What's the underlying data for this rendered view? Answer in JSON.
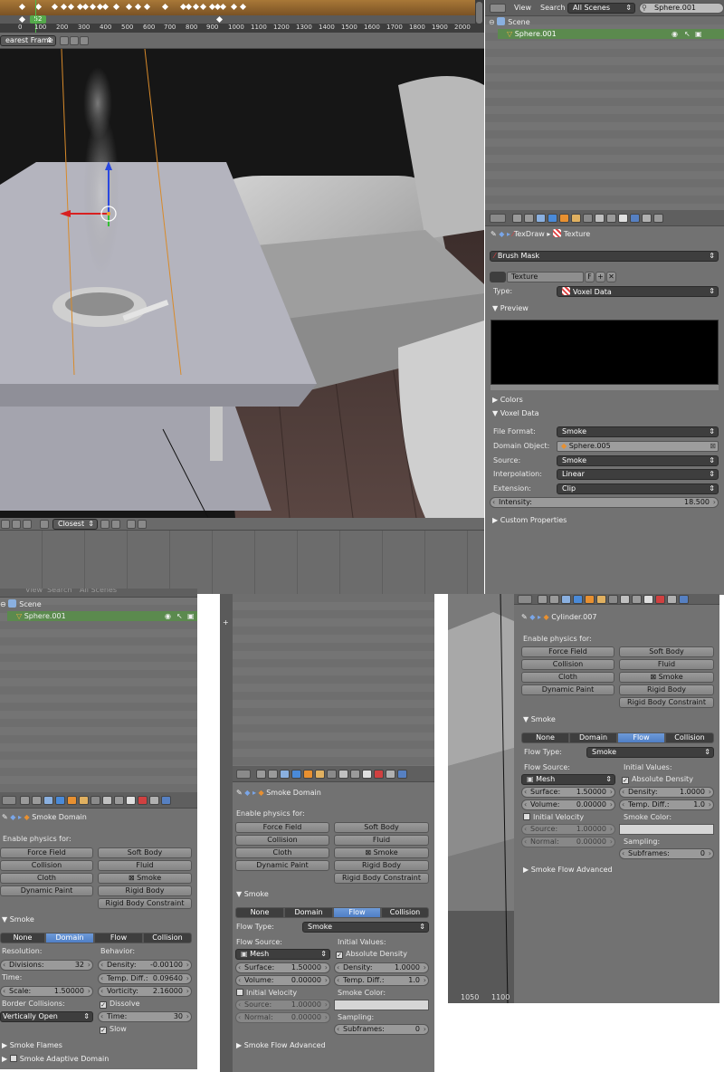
{
  "timeline": {
    "ticks": [
      "0",
      "0",
      "100",
      "200",
      "300",
      "400",
      "500",
      "600",
      "700",
      "800",
      "900",
      "1000",
      "1100",
      "1200",
      "1300",
      "1400",
      "1500",
      "1600",
      "1700",
      "1800",
      "1900",
      "2000",
      "2100"
    ],
    "current_frame": "52",
    "snap_mode": "earest Frame"
  },
  "viewport": {
    "shading_mode": "Closest"
  },
  "outliner_top": {
    "menu_view": "View",
    "menu_search": "Search",
    "scenes_dropdown": "All Scenes",
    "search_value": "Sphere.001",
    "tree_scene": "Scene",
    "tree_object": "Sphere.001"
  },
  "texture_panel": {
    "breadcrumb_brush": "TexDraw",
    "breadcrumb_texture": "Texture",
    "brush_mask": "Brush Mask",
    "texture_name": "Texture",
    "texture_f": "F",
    "type_label": "Type:",
    "type_value": "Voxel Data",
    "preview_header": "Preview",
    "colors_header": "Colors",
    "voxel_header": "Voxel Data",
    "file_format_label": "File Format:",
    "file_format_value": "Smoke",
    "domain_object_label": "Domain Object:",
    "domain_object_value": "Sphere.005",
    "source_label": "Source:",
    "source_value": "Smoke",
    "interpolation_label": "Interpolation:",
    "interpolation_value": "Linear",
    "extension_label": "Extension:",
    "extension_value": "Clip",
    "intensity_label": "Intensity:",
    "intensity_value": "18.500",
    "custom_props_header": "Custom Properties"
  },
  "outliner_small": {
    "menu_view": "View",
    "menu_search": "Search",
    "scenes": "All Scenes",
    "tree_scene": "Scene",
    "tree_object": "Sphere.001"
  },
  "physics_domain": {
    "object": "Smoke Domain",
    "enable_label": "Enable physics for:",
    "force_field": "Force Field",
    "soft_body": "Soft Body",
    "collision": "Collision",
    "fluid": "Fluid",
    "cloth": "Cloth",
    "smoke": "Smoke",
    "dynamic_paint": "Dynamic Paint",
    "rigid_body": "Rigid Body",
    "rigid_body_constraint": "Rigid Body Constraint",
    "smoke_header": "Smoke",
    "tab_none": "None",
    "tab_domain": "Domain",
    "tab_flow": "Flow",
    "tab_collision": "Collision",
    "resolution_label": "Resolution:",
    "divisions_label": "Divisions:",
    "divisions_value": "32",
    "time_label": "Time:",
    "scale_label": "Scale:",
    "scale_value": "1.50000",
    "border_label": "Border Collisions:",
    "border_value": "Vertically Open",
    "behavior_label": "Behavior:",
    "density_label": "Density:",
    "density_value": "-0.00100",
    "temp_diff_label": "Temp. Diff.:",
    "temp_diff_value": "0.09640",
    "vorticity_label": "Vorticity:",
    "vorticity_value": "2.16000",
    "dissolve_label": "Dissolve",
    "time_field_label": "Time:",
    "time_field_value": "30",
    "slow_label": "Slow",
    "flames_header": "Smoke Flames",
    "adaptive_header": "Smoke Adaptive Domain"
  },
  "physics_flow_mid": {
    "object": "Smoke Domain",
    "enable_label": "Enable physics for:",
    "force_field": "Force Field",
    "soft_body": "Soft Body",
    "collision": "Collision",
    "fluid": "Fluid",
    "cloth": "Cloth",
    "smoke": "Smoke",
    "dynamic_paint": "Dynamic Paint",
    "rigid_body": "Rigid Body",
    "rigid_body_constraint": "Rigid Body Constraint",
    "smoke_header": "Smoke",
    "tab_none": "None",
    "tab_domain": "Domain",
    "tab_flow": "Flow",
    "tab_collision": "Collision",
    "flow_type_label": "Flow Type:",
    "flow_type_value": "Smoke",
    "flow_source_label": "Flow Source:",
    "flow_source_value": "Mesh",
    "initial_values_label": "Initial Values:",
    "absolute_density_label": "Absolute Density",
    "surface_label": "Surface:",
    "surface_value": "1.50000",
    "volume_label": "Volume:",
    "volume_value": "0.00000",
    "density_label": "Density:",
    "density_value": "1.0000",
    "temp_diff_label": "Temp. Diff.:",
    "temp_diff_value": "1.0",
    "initial_velocity_label": "Initial Velocity",
    "smoke_color_label": "Smoke Color:",
    "source_label": "Source:",
    "source_value": "1.00000",
    "normal_label": "Normal:",
    "normal_value": "0.00000",
    "sampling_label": "Sampling:",
    "subframes_label": "Subframes:",
    "subframes_value": "0",
    "advanced_header": "Smoke Flow Advanced"
  },
  "physics_flow_right": {
    "object": "Cylinder.007",
    "enable_label": "Enable physics for:",
    "force_field": "Force Field",
    "soft_body": "Soft Body",
    "collision": "Collision",
    "fluid": "Fluid",
    "cloth": "Cloth",
    "smoke": "Smoke",
    "dynamic_paint": "Dynamic Paint",
    "rigid_body": "Rigid Body",
    "rigid_body_constraint": "Rigid Body Constraint",
    "smoke_header": "Smoke",
    "tab_none": "None",
    "tab_domain": "Domain",
    "tab_flow": "Flow",
    "tab_collision": "Collision",
    "flow_type_label": "Flow Type:",
    "flow_type_value": "Smoke",
    "flow_source_label": "Flow Source:",
    "flow_source_value": "Mesh",
    "initial_values_label": "Initial Values:",
    "absolute_density_label": "Absolute Density",
    "surface_label": "Surface:",
    "surface_value": "1.50000",
    "volume_label": "Volume:",
    "volume_value": "0.00000",
    "density_label": "Density:",
    "density_value": "1.0000",
    "temp_diff_label": "Temp. Diff.:",
    "temp_diff_value": "1.0",
    "initial_velocity_label": "Initial Velocity",
    "smoke_color_label": "Smoke Color:",
    "source_label": "Source:",
    "source_value": "1.00000",
    "normal_label": "Normal:",
    "normal_value": "0.00000",
    "sampling_label": "Sampling:",
    "subframes_label": "Subframes:",
    "subframes_value": "0",
    "advanced_header": "Smoke Flow Advanced",
    "bottom_ticks": [
      "1050",
      "1100"
    ]
  },
  "colors": {
    "selected_blue": "#5680c2",
    "panel_bg": "#727272",
    "selected_row": "#5b8a4e"
  }
}
